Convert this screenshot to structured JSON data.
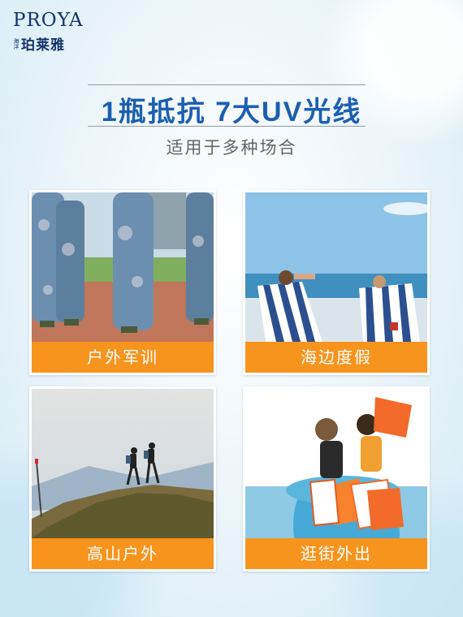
{
  "brand": {
    "name_en": "PROYA",
    "name_cn": "珀莱雅",
    "small_text": "海洋"
  },
  "headline": "1瓶抵抗 7大UV光线",
  "subheadline": "适用于多种场合",
  "colors": {
    "brand_navy": "#14336b",
    "headline_blue": "#1c5fb0",
    "label_orange": "#f7941d"
  },
  "scenes": [
    {
      "label": "户外军训",
      "image": "military-training-photo"
    },
    {
      "label": "海边度假",
      "image": "beach-vacation-photo"
    },
    {
      "label": "高山户外",
      "image": "mountain-hiking-photo"
    },
    {
      "label": "逛街外出",
      "image": "shopping-outing-photo"
    }
  ]
}
